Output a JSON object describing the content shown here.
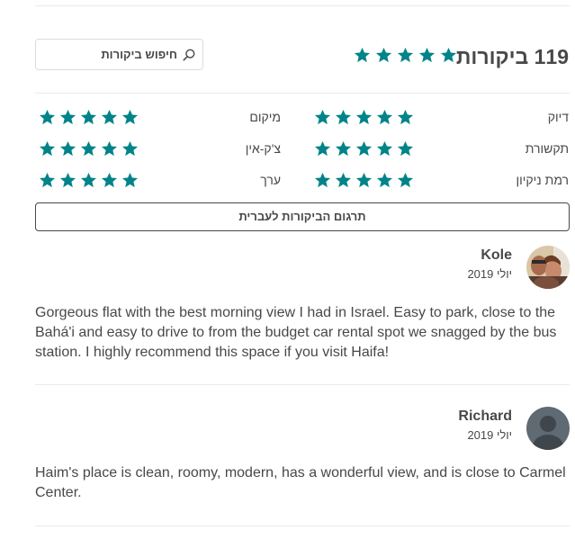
{
  "header": {
    "reviews_count_label": "119 ביקורות",
    "overall_rating_stars": 5
  },
  "search": {
    "placeholder": "חיפוש ביקורות"
  },
  "categories": [
    {
      "label": "דיוק",
      "stars": 5
    },
    {
      "label": "מיקום",
      "stars": 5
    },
    {
      "label": "תקשורת",
      "stars": 5
    },
    {
      "label": "צ'ק-אין",
      "stars": 5
    },
    {
      "label": "רמת ניקיון",
      "stars": 5
    },
    {
      "label": "ערך",
      "stars": 5
    }
  ],
  "translate_button": {
    "label": "תרגום הביקורות לעברית"
  },
  "reviews": [
    {
      "name": "Kole",
      "date": "יולי 2019",
      "text": "Gorgeous flat with the best morning view I had in Israel. Easy to park, close to the Bahá'i and easy to drive to from the budget car rental spot we snagged by the bus station. I highly recommend this space if you visit Haifa!"
    },
    {
      "name": "Richard",
      "date": "יולי 2019",
      "text": "Haim's place is clean, roomy, modern, has a wonderful view, and is close to Carmel Center."
    }
  ],
  "colors": {
    "star": "#008489",
    "text": "#484848",
    "divider": "#ebebeb"
  }
}
